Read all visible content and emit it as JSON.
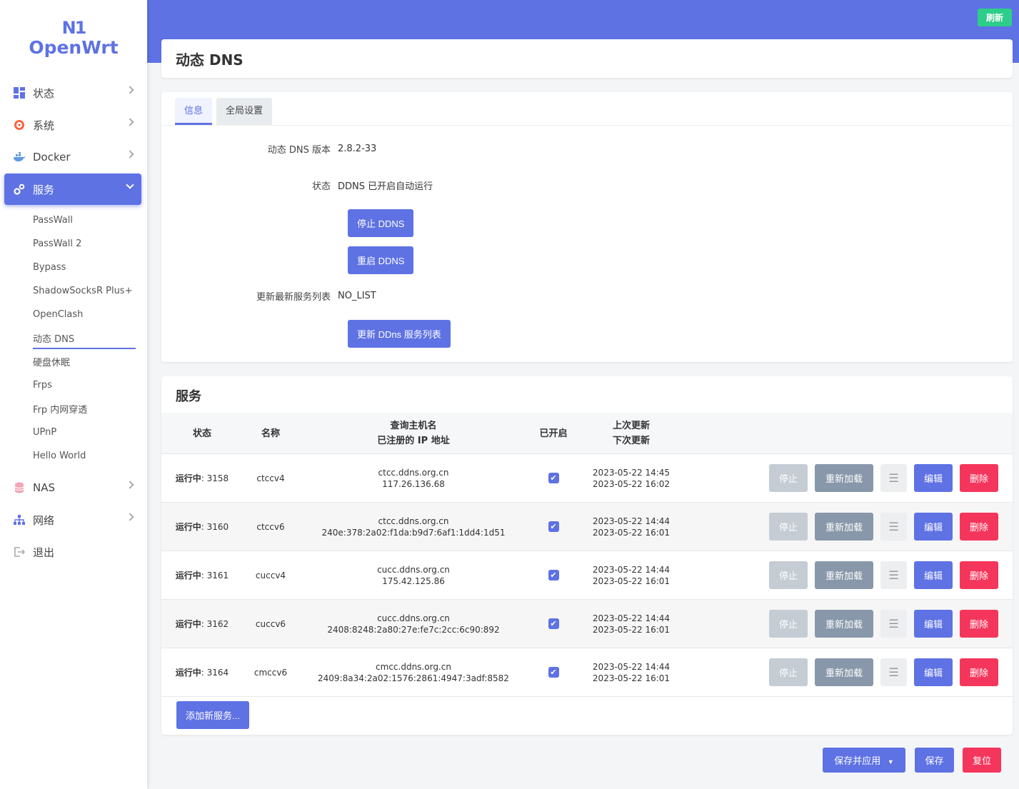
{
  "brand": {
    "line1": "N1",
    "line2": "OpenWrt"
  },
  "sidebar": {
    "menu": [
      {
        "label": "状态",
        "icon": "dashboard-icon"
      },
      {
        "label": "系统",
        "icon": "gear-icon"
      },
      {
        "label": "Docker",
        "icon": "docker-icon"
      },
      {
        "label": "服务",
        "icon": "services-icon"
      }
    ],
    "submenu": [
      "PassWall",
      "PassWall 2",
      "Bypass",
      "ShadowSocksR Plus+",
      "OpenClash",
      "动态 DNS",
      "硬盘休眠",
      "Frps",
      "Frp 内网穿透",
      "UPnP",
      "Hello World"
    ],
    "menu_after": [
      {
        "label": "NAS",
        "icon": "database-icon"
      },
      {
        "label": "网络",
        "icon": "network-icon"
      },
      {
        "label": "退出",
        "icon": "logout-icon"
      }
    ]
  },
  "topbar": {
    "refresh": "刷新"
  },
  "page": {
    "title": "动态 DNS"
  },
  "tabs": [
    "信息",
    "全局设置"
  ],
  "info": {
    "version_label": "动态 DNS 版本",
    "version_value": "2.8.2-33",
    "status_label": "状态",
    "status_value": "DDNS 已开启自动运行",
    "stop_btn": "停止 DDNS",
    "restart_btn": "重启 DDNS",
    "update_label": "更新最新服务列表",
    "update_value": "NO_LIST",
    "update_btn": "更新 DDns 服务列表"
  },
  "services": {
    "title": "服务",
    "headers": {
      "status": "状态",
      "name": "名称",
      "host1": "查询主机名",
      "host2": "已注册的 IP 地址",
      "enabled": "已开启",
      "upd1": "上次更新",
      "upd2": "下次更新"
    },
    "rows": [
      {
        "status": "运行中",
        "pid": ": 3158",
        "name": "ctccv4",
        "host": "ctcc.ddns.org.cn",
        "ip": "117.26.136.68",
        "last": "2023-05-22 14:45",
        "next": "2023-05-22 16:02"
      },
      {
        "status": "运行中",
        "pid": ": 3160",
        "name": "ctccv6",
        "host": "ctcc.ddns.org.cn",
        "ip": "240e:378:2a02:f1da:b9d7:6af1:1dd4:1d51",
        "last": "2023-05-22 14:44",
        "next": "2023-05-22 16:01"
      },
      {
        "status": "运行中",
        "pid": ": 3161",
        "name": "cuccv4",
        "host": "cucc.ddns.org.cn",
        "ip": "175.42.125.86",
        "last": "2023-05-22 14:44",
        "next": "2023-05-22 16:01"
      },
      {
        "status": "运行中",
        "pid": ": 3162",
        "name": "cuccv6",
        "host": "cucc.ddns.org.cn",
        "ip": "2408:8248:2a80:27e:fe7c:2cc:6c90:892",
        "last": "2023-05-22 14:44",
        "next": "2023-05-22 16:01"
      },
      {
        "status": "运行中",
        "pid": ": 3164",
        "name": "cmccv6",
        "host": "cmcc.ddns.org.cn",
        "ip": "2409:8a34:2a02:1576:2861:4947:3adf:8582",
        "last": "2023-05-22 14:44",
        "next": "2023-05-22 16:01"
      }
    ],
    "actions": {
      "stop": "停止",
      "reload": "重新加载",
      "menu": "☰",
      "edit": "编辑",
      "delete": "删除"
    },
    "add_btn": "添加新服务..."
  },
  "footer": {
    "apply": "保存并应用",
    "apply_caret": "▼",
    "save": "保存",
    "reset": "复位"
  }
}
